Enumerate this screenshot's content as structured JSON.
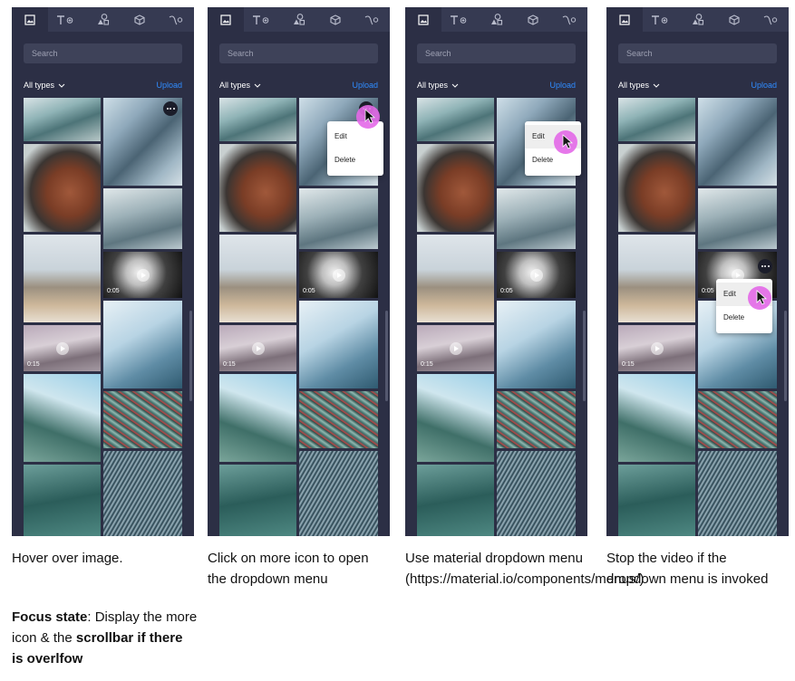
{
  "panels": [
    {
      "id": "p1",
      "search_placeholder": "Search",
      "filter_label": "All types",
      "upload_label": "Upload"
    },
    {
      "id": "p2",
      "search_placeholder": "Search",
      "filter_label": "All types",
      "upload_label": "Upload"
    },
    {
      "id": "p3",
      "search_placeholder": "Search",
      "filter_label": "All types",
      "upload_label": "Upload"
    },
    {
      "id": "p4",
      "search_placeholder": "Search",
      "filter_label": "All types",
      "upload_label": "Upload"
    }
  ],
  "tab_icons": [
    "image-icon",
    "text-icon",
    "shapes-icon",
    "3d-cube-icon",
    "path-icon"
  ],
  "video_durations": {
    "a": "0:05",
    "b": "0:15"
  },
  "menu": {
    "edit": "Edit",
    "delete": "Delete"
  },
  "captions": {
    "c1": "Hover over image.",
    "c2": "Click on more icon to open the dropdown menu",
    "c3": "Use material dropdown menu (https://material.io/components/menus/)",
    "c4": "Stop the video if the dropdown menu is invoked"
  },
  "focus_note": {
    "label": "Focus state",
    "text1": ": Display the more icon & the ",
    "bold2": "scrollbar if there is overlfow"
  },
  "colors": {
    "panel_bg": "#2c2f45",
    "tab_bar": "#363a52",
    "accent": "#2f8cff",
    "cursor_highlight": "#e46ae8"
  }
}
